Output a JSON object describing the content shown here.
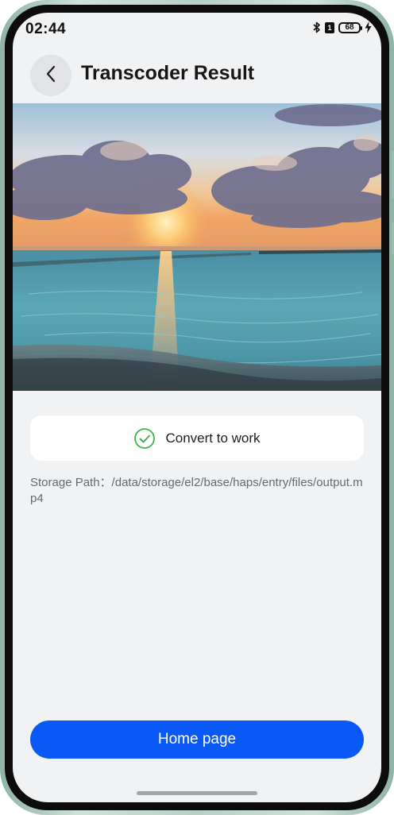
{
  "status_bar": {
    "time": "02:44",
    "sim_label": "1",
    "battery_level": "68"
  },
  "header": {
    "title": "Transcoder Result"
  },
  "preview": {
    "image_description": "sunset-over-sea"
  },
  "result": {
    "message": "Convert to work",
    "status_color": "#3bb54a"
  },
  "storage": {
    "path_text": "Storage Path：/data/storage/el2/base/haps/entry/files/output.mp4"
  },
  "actions": {
    "home_label": "Home page",
    "home_color": "#0a59f7"
  },
  "icons": {
    "back": "chevron-left-icon",
    "bluetooth": "bluetooth-icon",
    "battery": "battery-icon",
    "charging": "bolt-icon",
    "success": "check-circle-icon"
  }
}
